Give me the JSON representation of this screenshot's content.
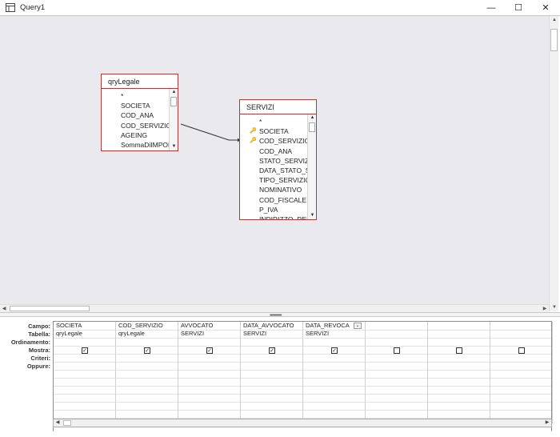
{
  "window": {
    "title": "Query1",
    "minimize_glyph": "—",
    "maximize_glyph": "☐",
    "close_glyph": "✕"
  },
  "icons": {
    "app": "query-icon",
    "key": "key-icon",
    "scroll_up": "▲",
    "scroll_down": "▼",
    "scroll_left": "◀",
    "scroll_right": "▶",
    "dropdown": "⌄",
    "check": "✓"
  },
  "colors": {
    "design_background": "#eaeaee",
    "table_border": "#b03a3a",
    "relationship_line": "#333333"
  },
  "tables": [
    {
      "name": "qryLegale",
      "fields": [
        {
          "name": "*",
          "key": false
        },
        {
          "name": "SOCIETA",
          "key": false
        },
        {
          "name": "COD_ANA",
          "key": false
        },
        {
          "name": "COD_SERVIZIO",
          "key": false
        },
        {
          "name": "AGEING",
          "key": false
        },
        {
          "name": "SommaDiIMPORTO",
          "key": false
        }
      ]
    },
    {
      "name": "SERVIZI",
      "fields": [
        {
          "name": "*",
          "key": false
        },
        {
          "name": "SOCIETA",
          "key": true
        },
        {
          "name": "COD_SERVIZIO",
          "key": true
        },
        {
          "name": "COD_ANA",
          "key": false
        },
        {
          "name": "STATO_SERVIZIO",
          "key": false
        },
        {
          "name": "DATA_STATO_SERVIZIO",
          "key": false
        },
        {
          "name": "TIPO_SERVIZIO",
          "key": false
        },
        {
          "name": "NOMINATIVO",
          "key": false
        },
        {
          "name": "COD_FISCALE",
          "key": false
        },
        {
          "name": "P_IVA",
          "key": false
        },
        {
          "name": "INDIRIZZO_RES",
          "key": false
        }
      ]
    }
  ],
  "grid": {
    "row_labels": [
      "Campo:",
      "Tabella:",
      "Ordinamento:",
      "Mostra:",
      "Criteri:",
      "Oppure:"
    ],
    "columns": [
      {
        "campo": "SOCIETA",
        "tabella": "qryLegale",
        "mostra": true
      },
      {
        "campo": "COD_SERVIZIO",
        "tabella": "qryLegale",
        "mostra": true
      },
      {
        "campo": "AVVOCATO",
        "tabella": "SERVIZI",
        "mostra": true
      },
      {
        "campo": "DATA_AVVOCATO",
        "tabella": "SERVIZI",
        "mostra": true
      },
      {
        "campo": "DATA_REVOCA",
        "tabella": "SERVIZI",
        "mostra": true,
        "dropdown": true
      },
      {
        "campo": "",
        "tabella": "",
        "mostra": false
      },
      {
        "campo": "",
        "tabella": "",
        "mostra": false
      },
      {
        "campo": "",
        "tabella": "",
        "mostra": false
      }
    ]
  }
}
